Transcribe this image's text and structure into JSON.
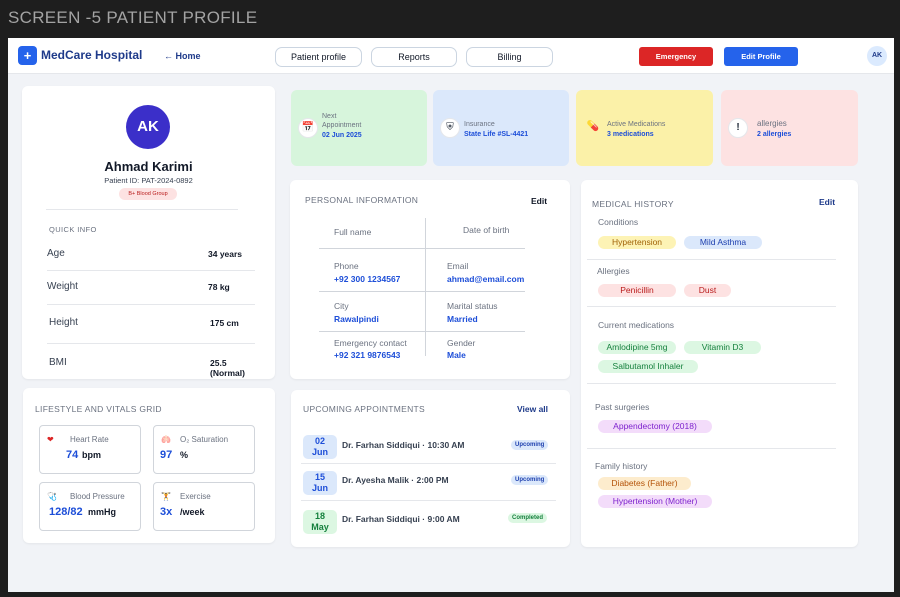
{
  "screen_label": "SCREEN -5 PATIENT PROFILE",
  "topbar": {
    "logo_glyph": "+",
    "brand": "MedCare Hospital",
    "home_link": "← Home",
    "nav": [
      "Patient profile",
      "Reports",
      "Billing"
    ],
    "emergency_label": "Emergency",
    "edit_profile_label": "Edit Profile",
    "avatar_initials": "AK"
  },
  "profile": {
    "initials": "AK",
    "name": "Ahmad Karimi",
    "patient_id": "Patient ID: PAT-2024-0892",
    "blood_group": "B+ Blood Group",
    "quick_info_title": "QUICK INFO",
    "quick_info": [
      {
        "label": "Age",
        "value": "34 years"
      },
      {
        "label": "Weight",
        "value": "78 kg"
      },
      {
        "label": "Height",
        "value": "175 cm"
      },
      {
        "label": "BMI",
        "value": "25.5 (Normal)"
      }
    ]
  },
  "stats": [
    {
      "icon": "calendar-icon",
      "glyph": "📅",
      "label": "Next Appointment",
      "value": "02 Jun 2025",
      "bg": "#d7f5dc"
    },
    {
      "icon": "shield-icon",
      "glyph": "⛨",
      "label": "Insurance",
      "value": "State Life #SL-4421",
      "bg": "#dbe8fb"
    },
    {
      "icon": "pill-icon",
      "glyph": "💊",
      "label": "Active Medications",
      "value": "3 medications",
      "bg": "#fbf1a8"
    },
    {
      "icon": "alert-icon",
      "glyph": "!",
      "label": "allergies",
      "value": "2 allergies",
      "bg": "#fde2e2"
    }
  ],
  "personal": {
    "title": "PERSONAL INFORMATION",
    "edit": "Edit",
    "full_name_label": "Full name",
    "dob_label": "Date of birth",
    "phone_label": "Phone",
    "phone": "+92 300 1234567",
    "email_label": "Email",
    "email": "ahmad@email.com",
    "city_label": "City",
    "city": "Rawalpindi",
    "marital_label": "Marital status",
    "marital": "Married",
    "emergency_label": "Emergency contact",
    "emergency": "+92 321 9876543",
    "gender_label": "Gender",
    "gender": "Male"
  },
  "medical": {
    "title": "MEDICAL HISTORY",
    "edit": "Edit",
    "conditions_label": "Conditions",
    "conditions": [
      "Hypertension",
      "Mild Asthma"
    ],
    "allergies_label": "Allergies",
    "allergies": [
      "Penicillin",
      "Dust"
    ],
    "meds_label": "Current medications",
    "meds": [
      "Amlodipine 5mg",
      "Vitamin D3",
      "Salbutamol Inhaler"
    ],
    "surgeries_label": "Past surgeries",
    "surgeries": [
      "Appendectomy (2018)"
    ],
    "family_label": "Family history",
    "family": [
      "Diabetes (Father)",
      "Hypertension (Mother)"
    ]
  },
  "appointments": {
    "title": "UPCOMING APPOINTMENTS",
    "view_all": "View all",
    "items": [
      {
        "day": "02",
        "month": "Jun",
        "doctor": "Dr. Farhan Siddiqui · 10:30 AM",
        "status": "Upcoming"
      },
      {
        "day": "15",
        "month": "Jun",
        "doctor": "Dr. Ayesha Malik · 2:00 PM",
        "status": "Upcoming"
      },
      {
        "day": "18",
        "month": "May",
        "doctor": "Dr. Farhan Siddiqui · 9:00 AM",
        "status": "Completed"
      }
    ]
  },
  "lifestyle": {
    "title": "LIFESTYLE AND VITALS GRID",
    "vitals": [
      {
        "icon": "heart-icon",
        "glyph": "❤",
        "label": "Heart Rate",
        "value": "74",
        "unit": "bpm"
      },
      {
        "icon": "lungs-icon",
        "glyph": "🫁",
        "label": "O₂ Saturation",
        "value": "97",
        "unit": "%"
      },
      {
        "icon": "blood-pressure-icon",
        "glyph": "🩺",
        "label": "Blood Pressure",
        "value": "128/82",
        "unit": "mmHg"
      },
      {
        "icon": "exercise-icon",
        "glyph": "🏋",
        "label": "Exercise",
        "value": "3x",
        "unit": "/week"
      }
    ]
  }
}
